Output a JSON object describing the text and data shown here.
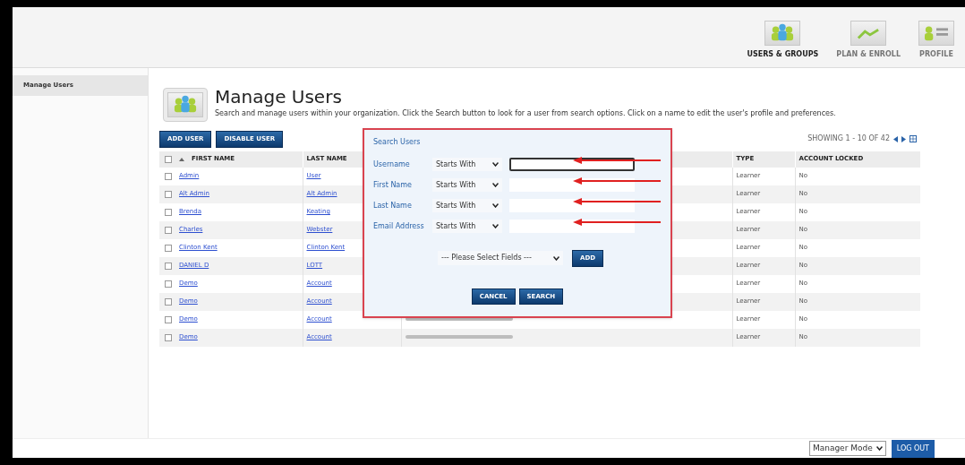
{
  "nav": [
    {
      "label": "USERS & GROUPS",
      "kind": "users",
      "selected": true
    },
    {
      "label": "PLAN & ENROLL",
      "kind": "plan",
      "selected": false
    },
    {
      "label": "PROFILE",
      "kind": "profile",
      "selected": false
    }
  ],
  "sidebar": {
    "items": [
      {
        "label": "Manage Users",
        "selected": true
      }
    ]
  },
  "page": {
    "title": "Manage Users",
    "description": "Search and manage users within your organization. Click the Search button to look for a user from search options. Click on a name to edit the user's profile and preferences."
  },
  "toolbar": {
    "buttons": [
      "ADD USER",
      "DISABLE USER"
    ],
    "paging": "SHOWING 1 - 10 OF 42"
  },
  "table": {
    "all_checked": false,
    "columns": [
      "FIRST NAME",
      "LAST NAME",
      "TYPE",
      "ACCOUNT LOCKED"
    ],
    "rows": [
      {
        "first": "Admin",
        "last": "User",
        "type": "Learner",
        "locked": "No",
        "checked": false
      },
      {
        "first": "Alt Admin",
        "last": "Alt Admin",
        "type": "Learner",
        "locked": "No",
        "checked": false
      },
      {
        "first": "Brenda",
        "last": "Keating",
        "type": "Learner",
        "locked": "No",
        "checked": false
      },
      {
        "first": "Charles",
        "last": "Webster",
        "type": "Learner",
        "locked": "No",
        "checked": false
      },
      {
        "first": "Clinton Kent",
        "last": "Clinton Kent",
        "type": "Learner",
        "locked": "No",
        "checked": false
      },
      {
        "first": "DANIEL D",
        "last": "LOTT",
        "type": "Learner",
        "locked": "No",
        "checked": false
      },
      {
        "first": "Demo",
        "last": "Account",
        "type": "Learner",
        "locked": "No",
        "checked": false
      },
      {
        "first": "Demo",
        "last": "Account",
        "type": "Learner",
        "locked": "No",
        "checked": false
      },
      {
        "first": "Demo",
        "last": "Account",
        "type": "Learner",
        "locked": "No",
        "checked": false
      },
      {
        "first": "Demo",
        "last": "Account",
        "type": "Learner",
        "locked": "No",
        "checked": false
      }
    ]
  },
  "search_dialog": {
    "title": "Search Users",
    "fields": [
      {
        "label": "Username",
        "operator": "Starts With",
        "focused": true
      },
      {
        "label": "First Name",
        "operator": "Starts With",
        "focused": false
      },
      {
        "label": "Last Name",
        "operator": "Starts With",
        "focused": false
      },
      {
        "label": "Email Address",
        "operator": "Starts With",
        "focused": false
      }
    ],
    "field_picker": "--- Please Select Fields ---",
    "add_button": "ADD",
    "buttons": [
      "CANCEL",
      "SEARCH"
    ]
  },
  "footer": {
    "mode": "Manager Mode",
    "logout": "LOG OUT"
  }
}
